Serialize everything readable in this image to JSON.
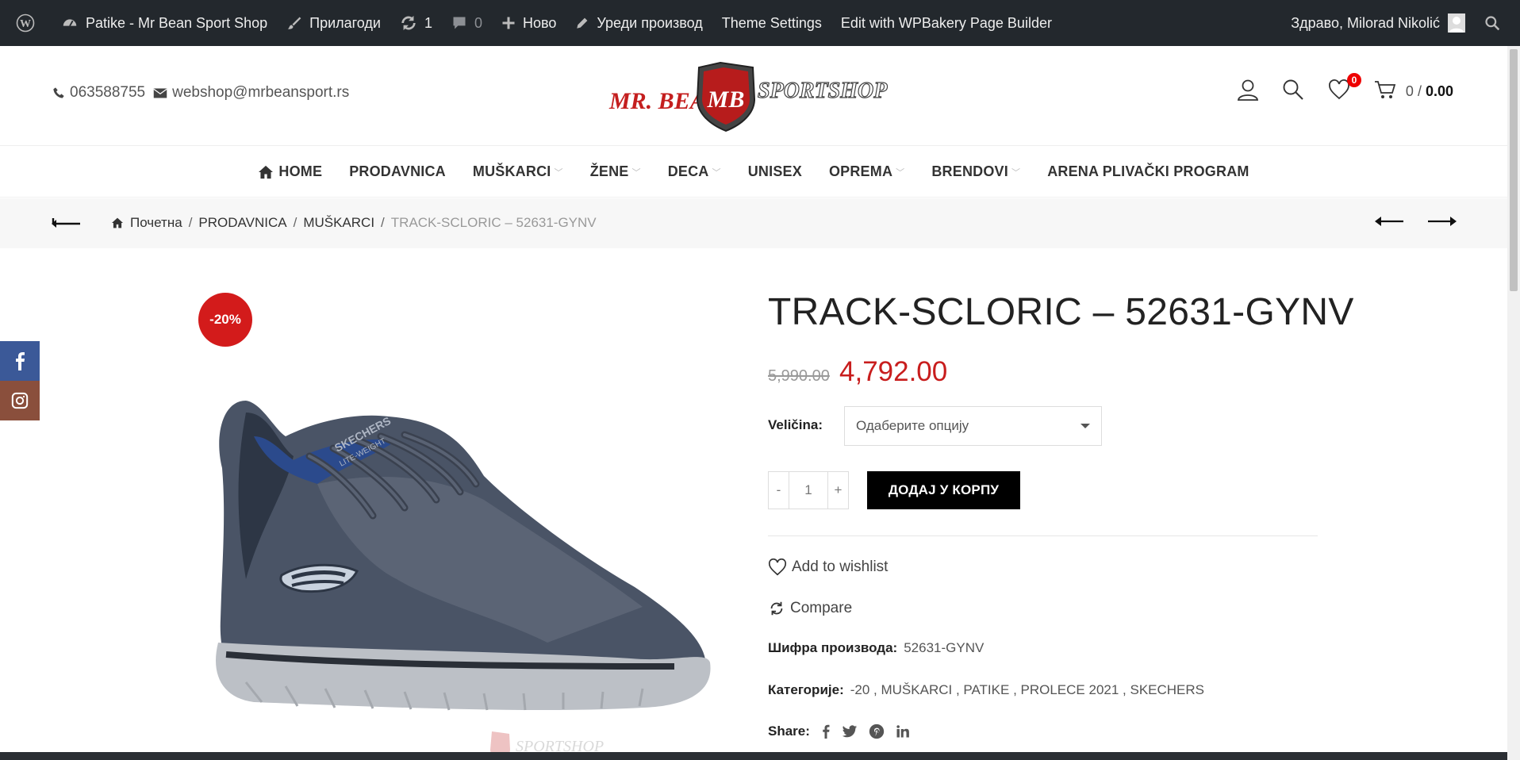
{
  "admin_bar": {
    "site_name": "Patike - Mr Bean Sport Shop",
    "customize": "Прилагоди",
    "updates_count": "1",
    "comments_count": "0",
    "new": "Ново",
    "edit_product": "Уреди производ",
    "theme_settings": "Theme Settings",
    "wpbakery": "Edit with WPBakery Page Builder",
    "greeting": "Здраво, Milorad Nikolić"
  },
  "header": {
    "phone": "063588755",
    "email": "webshop@mrbeansport.rs",
    "logo_left": "MR. BEAN",
    "logo_right": "SPORTSHOP",
    "logo_mono": "MB",
    "wishlist_count": "0",
    "cart_count": "0",
    "cart_sep": " / ",
    "cart_total": "0.00"
  },
  "nav": {
    "items": [
      {
        "label": "HOME"
      },
      {
        "label": "PRODAVNICA"
      },
      {
        "label": "MUŠKARCI"
      },
      {
        "label": "ŽENE"
      },
      {
        "label": "DECA"
      },
      {
        "label": "UNISEX"
      },
      {
        "label": "OPREMA"
      },
      {
        "label": "BRENDOVI"
      },
      {
        "label": "ARENA PLIVAČKI PROGRAM"
      }
    ]
  },
  "breadcrumb": {
    "home": "Почетна",
    "shop": "PRODAVNICA",
    "category": "MUŠKARCI",
    "current": "TRACK-SCLORIC – 52631-GYNV",
    "sep": "/"
  },
  "product": {
    "sale_badge": "-20%",
    "title": "TRACK-SCLORIC – 52631-GYNV",
    "old_price": "5,990.00",
    "new_price": "4,792.00",
    "size_label": "Veličina",
    "size_placeholder": "Одаберите опцију",
    "qty_minus": "-",
    "qty_value": "1",
    "qty_plus": "+",
    "add_to_cart": "ДОДАЈ У КОРПУ",
    "wishlist": "Add to wishlist",
    "compare": "Compare",
    "sku_label": "Шифра производа:",
    "sku": "52631-GYNV",
    "categories_label": "Категорије:",
    "categories": [
      "-20",
      "MUŠKARCI",
      "PATIKE",
      "PROLECE 2021",
      "SKECHERS"
    ],
    "share_label": "Share:",
    "shoe_brand_text": "SKECHERS",
    "shoe_model_text": "LITE-WEIGHT",
    "watermark": "SPORTSHOP"
  },
  "colors": {
    "admin_bg": "#23282d",
    "sale_red": "#d31b1b",
    "price_red": "#c81d1d",
    "facebook": "#3b5998",
    "instagram": "#8a4f3c"
  }
}
